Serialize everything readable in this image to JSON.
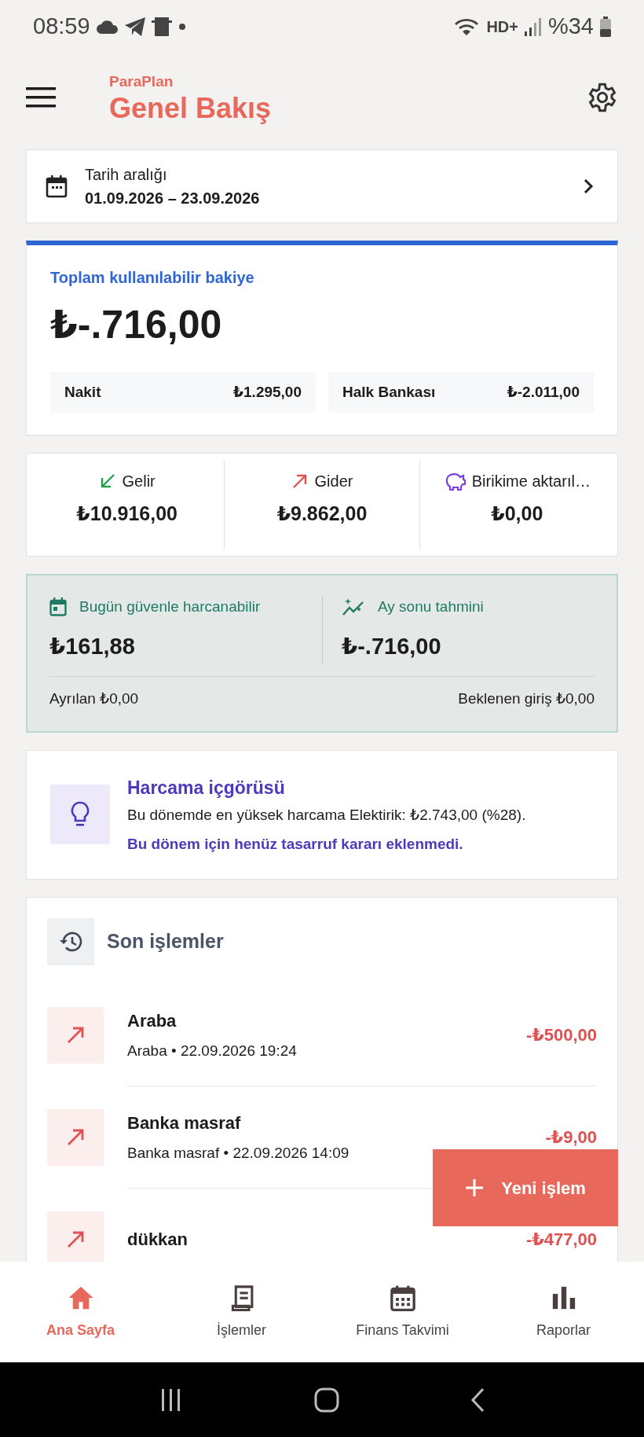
{
  "status_bar": {
    "time": "08:59",
    "network": "HD+",
    "battery": "%34"
  },
  "header": {
    "app_name": "ParaPlan",
    "title": "Genel Bakış"
  },
  "date_range": {
    "label": "Tarih aralığı",
    "value": "01.09.2026 – 23.09.2026"
  },
  "balance": {
    "label": "Toplam kullanılabilir bakiye",
    "amount": "₺-.716,00",
    "accounts": [
      {
        "name": "Nakit",
        "amount": "₺1.295,00"
      },
      {
        "name": "Halk Bankası",
        "amount": "₺-2.011,00"
      }
    ]
  },
  "summary": [
    {
      "kind": "income",
      "label": "Gelir",
      "amount": "₺10.916,00"
    },
    {
      "kind": "expense",
      "label": "Gider",
      "amount": "₺9.862,00"
    },
    {
      "kind": "savings",
      "label": "Birikime aktarıl…",
      "amount": "₺0,00"
    }
  ],
  "forecast": {
    "items": [
      {
        "kind": "today",
        "label": "Bugün güvenle harcanabilir",
        "amount": "₺161,88"
      },
      {
        "kind": "month_end",
        "label": "Ay sonu tahmini",
        "amount": "₺-.716,00"
      }
    ],
    "reserved": "Ayrılan ₺0,00",
    "expected": "Beklenen giriş ₺0,00"
  },
  "insight": {
    "title": "Harcama içgörüsü",
    "text": "Bu dönemde en yüksek harcama Elektirik: ₺2.743,00 (%28).",
    "note": "Bu dönem için henüz tasarruf kararı eklenmedi."
  },
  "recent": {
    "title": "Son işlemler",
    "transactions": [
      {
        "kind": "expense",
        "title": "Araba",
        "subtitle": "Araba • 22.09.2026 19:24",
        "amount": "-₺500,00"
      },
      {
        "kind": "expense",
        "title": "Banka masraf",
        "subtitle": "Banka masraf • 22.09.2026 14:09",
        "amount": "-₺9,00"
      },
      {
        "kind": "expense",
        "title": "dükkan",
        "amount": "-₺477,00"
      }
    ]
  },
  "fab": {
    "label": "Yeni işlem"
  },
  "bottom_nav": [
    {
      "kind": "home",
      "label": "Ana Sayfa",
      "selected": true
    },
    {
      "kind": "receipt",
      "label": "İşlemler",
      "selected": false
    },
    {
      "kind": "calendar",
      "label": "Finans Takvimi",
      "selected": false
    },
    {
      "kind": "chart",
      "label": "Raporlar",
      "selected": false
    }
  ]
}
